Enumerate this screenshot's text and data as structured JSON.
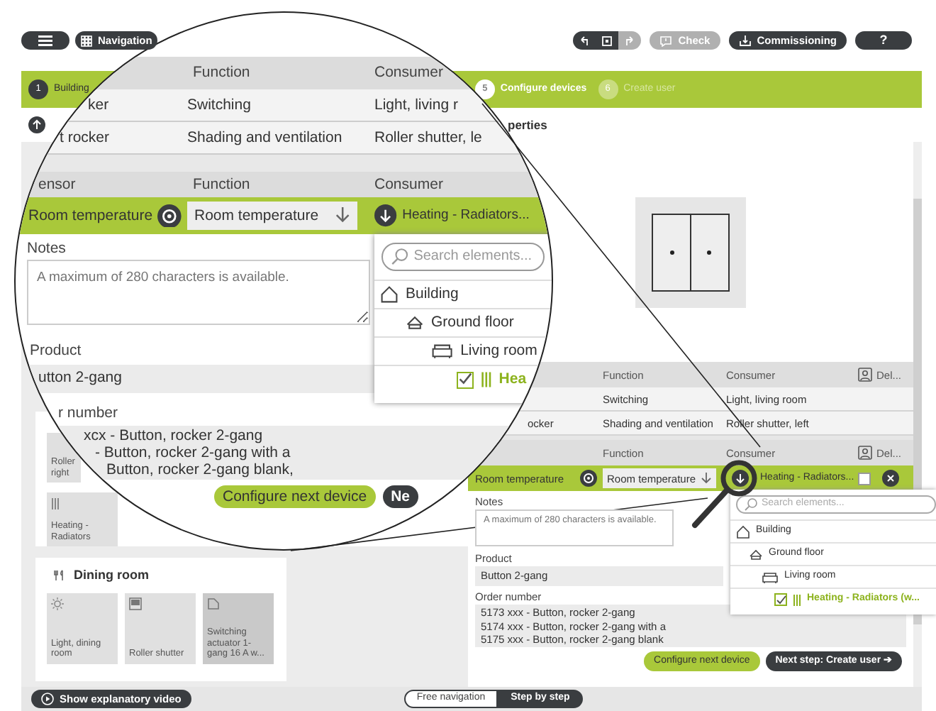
{
  "toolbar": {
    "navigation": "Navigation",
    "history": [
      {
        "kind": "undo",
        "disabled": false
      },
      {
        "kind": "device",
        "disabled": false
      },
      {
        "kind": "redo",
        "disabled": true
      }
    ],
    "check": {
      "label": "Check",
      "disabled": true
    },
    "commissioning": "Commissioning",
    "help": "?"
  },
  "steps": [
    {
      "number": "1",
      "label": "Building",
      "completed": true,
      "selected": false
    },
    {
      "number": "5",
      "label": "Configure devices",
      "completed": false,
      "selected": true
    },
    {
      "number": "6",
      "label": "Create user",
      "completed": false,
      "selected": false
    }
  ],
  "panel_heading": "perties",
  "left_panel": {
    "partial_tiles": [
      {
        "label": "Roller right"
      },
      {
        "label": "Heating - Radiators"
      }
    ],
    "room": {
      "title": "Dining room",
      "tiles": [
        {
          "label": "Light, dining room",
          "selected": false
        },
        {
          "label": "Roller shutter",
          "selected": false
        },
        {
          "label": "Switching actuator 1-gang 16 A w...",
          "selected": true
        }
      ]
    }
  },
  "assignments": {
    "columns": [
      "Function",
      "Consumer",
      "Del..."
    ],
    "rows": [
      {
        "function": "Switching",
        "consumer": "Light, living room"
      },
      {
        "sensor": "ocker",
        "function": "Shading and ventilation",
        "consumer": "Roller shutter, left"
      }
    ]
  },
  "editor": {
    "columns": [
      "Function",
      "Consumer",
      "Del..."
    ],
    "sensor": "Room temperature",
    "function": "Room temperature",
    "consumer": "Heating - Radiators...",
    "checked": false
  },
  "notes": {
    "label": "Notes",
    "placeholder": "A maximum of 280 characters is available."
  },
  "product": {
    "label": "Product",
    "value": "Button 2-gang"
  },
  "order_number": {
    "label": "Order number",
    "lines": [
      "5173 xxx - Button, rocker 2-gang",
      "5174 xxx - Button, rocker 2-gang with a",
      "5175 xxx - Button, rocker 2-gang blank"
    ]
  },
  "actions": {
    "configure_next": "Configure next device",
    "next_step": "Next step: Create user ➔"
  },
  "dropdown": {
    "search_placeholder": "Search elements...",
    "tree": [
      {
        "label": "Building",
        "kind": "building",
        "children": [
          {
            "label": "Ground floor",
            "kind": "floor",
            "children": [
              {
                "label": "Living room",
                "kind": "room",
                "children": [
                  {
                    "label": "Heating - Radiators (w...",
                    "kind": "consumer",
                    "checked": true
                  }
                ]
              }
            ]
          }
        ]
      }
    ]
  },
  "magnifier": {
    "header": [
      "Function",
      "Consumer"
    ],
    "rows": [
      {
        "sensor": "ker",
        "function": "Switching",
        "consumer": "Light, living r"
      },
      {
        "sensor": "t rocker",
        "function": "Shading and ventilation",
        "consumer": "Roller shutter, le"
      }
    ],
    "editor": {
      "columns": [
        "ensor",
        "Function",
        "Consumer"
      ],
      "sensor": "Room temperature",
      "function": "Room temperature",
      "consumer": "Heating - Radiators..."
    },
    "dropdown": {
      "search_placeholder": "Search elements...",
      "tree": [
        {
          "label": "Building",
          "kind": "building",
          "children": [
            {
              "label": "Ground floor",
              "kind": "floor",
              "children": [
                {
                  "label": "Living room",
                  "kind": "room",
                  "children": [
                    {
                      "label": "Hea",
                      "kind": "consumer",
                      "checked": true
                    }
                  ]
                }
              ]
            }
          ]
        }
      ]
    },
    "notes": {
      "label": "Notes",
      "placeholder": "A maximum of 280 characters is available."
    },
    "product": {
      "label": "Product",
      "value": "utton 2-gang"
    },
    "order_number": {
      "label": "r number",
      "lines": [
        "xcx - Button, rocker 2-gang",
        "- Button, rocker 2-gang with a",
        "Button, rocker 2-gang blank,"
      ]
    },
    "actions": {
      "configure_next": "Configure next device",
      "next_step": "Ne"
    }
  },
  "bottom_bar": {
    "video": "Show explanatory video",
    "modes": [
      {
        "label": "Free navigation",
        "selected": false
      },
      {
        "label": "Step by step",
        "selected": true
      }
    ]
  }
}
